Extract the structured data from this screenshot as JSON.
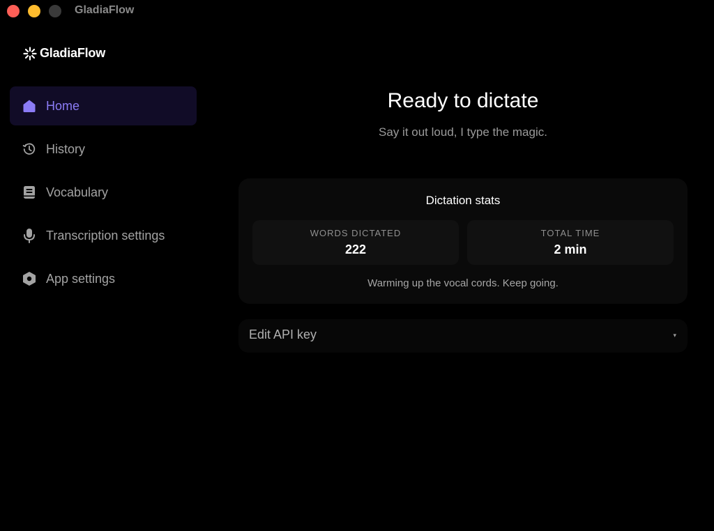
{
  "window": {
    "title": "GladiaFlow"
  },
  "brand": {
    "name": "GladiaFlow",
    "icon": "sparkle-logo-icon"
  },
  "sidebar": {
    "items": [
      {
        "label": "Home",
        "icon": "home-icon",
        "active": true
      },
      {
        "label": "History",
        "icon": "history-icon",
        "active": false
      },
      {
        "label": "Vocabulary",
        "icon": "book-icon",
        "active": false
      },
      {
        "label": "Transcription settings",
        "icon": "microphone-icon",
        "active": false
      },
      {
        "label": "App settings",
        "icon": "hexagon-settings-icon",
        "active": false
      }
    ]
  },
  "main": {
    "title": "Ready to dictate",
    "subtitle": "Say it out loud, I type the magic.",
    "stats": {
      "title": "Dictation stats",
      "words_label": "WORDS DICTATED",
      "words_value": "222",
      "time_label": "TOTAL TIME",
      "time_value": "2 min",
      "footer": "Warming up the vocal cords. Keep going."
    },
    "api_key": {
      "label": "Edit API key",
      "caret": "▾"
    }
  },
  "colors": {
    "accent": "#8b7cf6",
    "active_bg": "#110c27",
    "close": "#fe5f57",
    "minimize": "#febc2e",
    "maximize": "#3a3a3a"
  }
}
